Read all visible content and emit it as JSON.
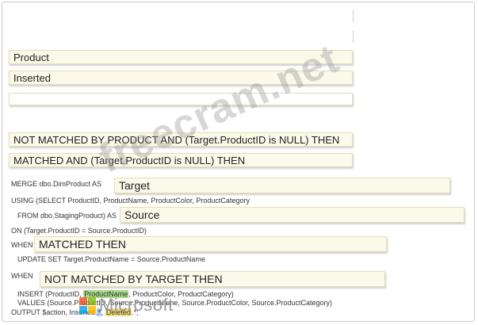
{
  "answer_boxes": [
    {
      "text": ""
    },
    {
      "text": ""
    },
    {
      "text": "Product"
    },
    {
      "text": "Inserted"
    },
    {
      "text": ""
    },
    {
      "text": "NOT MATCHED BY PRODUCT AND (Target.ProductID is NULL) THEN"
    },
    {
      "text": "MATCHED AND (Target.ProductID is NULL) THEN"
    }
  ],
  "statement": {
    "merge_label": "MERGE dbo.DimProduct AS",
    "target_slot": "Target",
    "using_line": "USING (SELECT ProductID, ProductName, ProductColor, ProductCategory",
    "from_label": "FROM dbo.StagingProduct) AS",
    "source_slot": "Source",
    "on_line": "ON (Target.ProductID = Source.ProductID)",
    "when_label_1": "WHEN",
    "when_slot_1": "MATCHED THEN",
    "update_line": "UPDATE SET Target.ProductName = Source.ProductName",
    "when_label_2": "WHEN",
    "when_slot_2": "NOT MATCHED BY TARGET THEN",
    "insert_prefix": "INSERT (ProductID, ",
    "insert_highlight": "ProductName",
    "insert_suffix": ", ProductColor, ProductCategory)",
    "values_line": "VALUES (Source.ProductID, Source.ProductName, Source.ProductColor, Source.ProductCategory)",
    "output_prefix": "OUTPUT $action, Inserted.",
    "output_star": "*",
    "output_mid": ", ",
    "output_deleted": "Deleted",
    "output_suffix": ".*;"
  },
  "watermark": "freecram.net",
  "logo": {
    "word": "Microsoft",
    "colors": [
      "#f25022",
      "#7fba00",
      "#00a4ef",
      "#ffb900"
    ]
  }
}
